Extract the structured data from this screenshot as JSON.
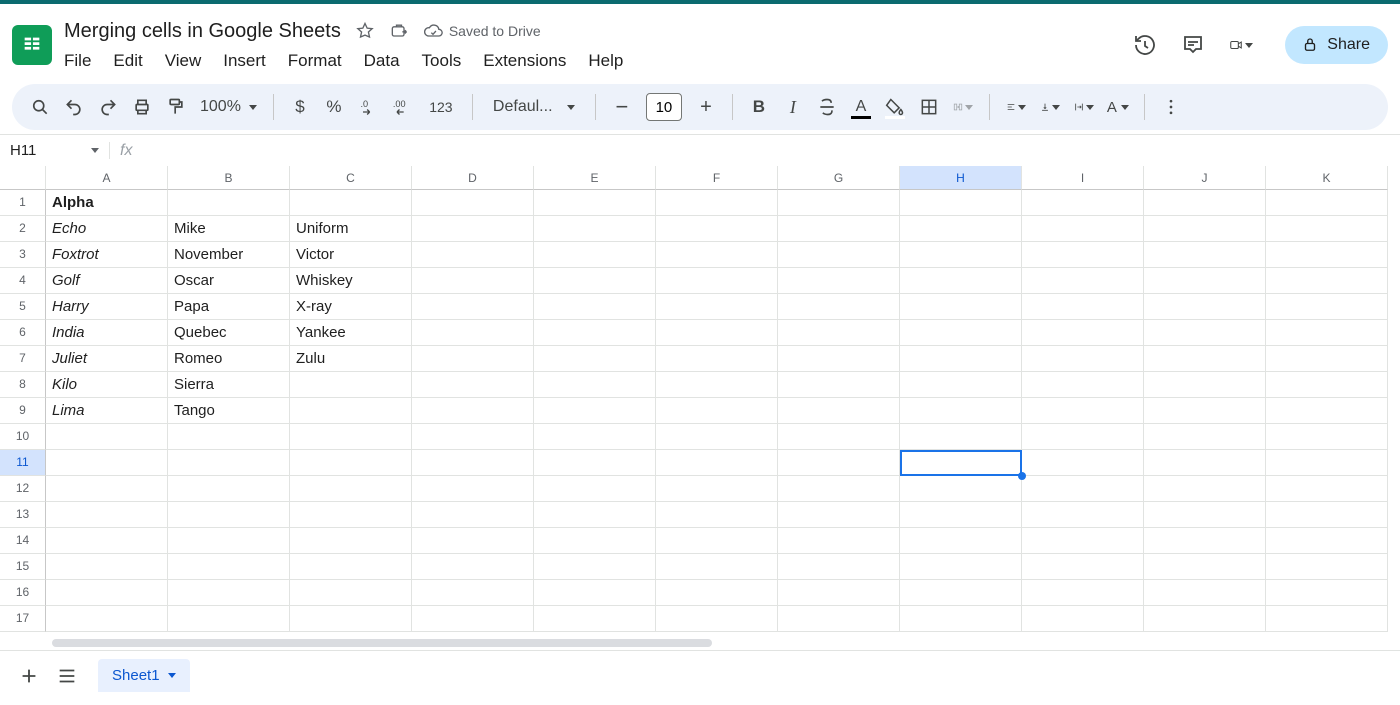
{
  "doc": {
    "title": "Merging cells in Google Sheets",
    "saved_text": "Saved to Drive"
  },
  "menus": {
    "file": "File",
    "edit": "Edit",
    "view": "View",
    "insert": "Insert",
    "format": "Format",
    "data": "Data",
    "tools": "Tools",
    "extensions": "Extensions",
    "help": "Help"
  },
  "topright": {
    "share": "Share"
  },
  "toolbar": {
    "zoom": "100%",
    "currency": "$",
    "percent": "%",
    "dec_dec": ".0",
    "dec_inc": ".00",
    "num123": "123",
    "font": "Defaul...",
    "fontsize": "10"
  },
  "namebox": {
    "ref": "H11"
  },
  "columns": [
    "A",
    "B",
    "C",
    "D",
    "E",
    "F",
    "G",
    "H",
    "I",
    "J",
    "K"
  ],
  "active_col_index": 7,
  "row_numbers": [
    "1",
    "2",
    "3",
    "4",
    "5",
    "6",
    "7",
    "8",
    "9",
    "10",
    "11",
    "12",
    "13",
    "14",
    "15",
    "16",
    "17"
  ],
  "active_row_index": 10,
  "cells": {
    "r1c0": "Alpha",
    "r2c0": "Echo",
    "r2c1": "Mike",
    "r2c2": "Uniform",
    "r3c0": "Foxtrot",
    "r3c1": "November",
    "r3c2": "Victor",
    "r4c0": "Golf",
    "r4c1": "Oscar",
    "r4c2": "Whiskey",
    "r5c0": "Harry",
    "r5c1": "Papa",
    "r5c2": "X-ray",
    "r6c0": "India",
    "r6c1": "Quebec",
    "r6c2": "Yankee",
    "r7c0": "Juliet",
    "r7c1": "Romeo",
    "r7c2": "Zulu",
    "r8c0": "Kilo",
    "r8c1": "Sierra",
    "r9c0": "Lima",
    "r9c1": "Tango"
  },
  "tabs": {
    "sheet1": "Sheet1"
  }
}
